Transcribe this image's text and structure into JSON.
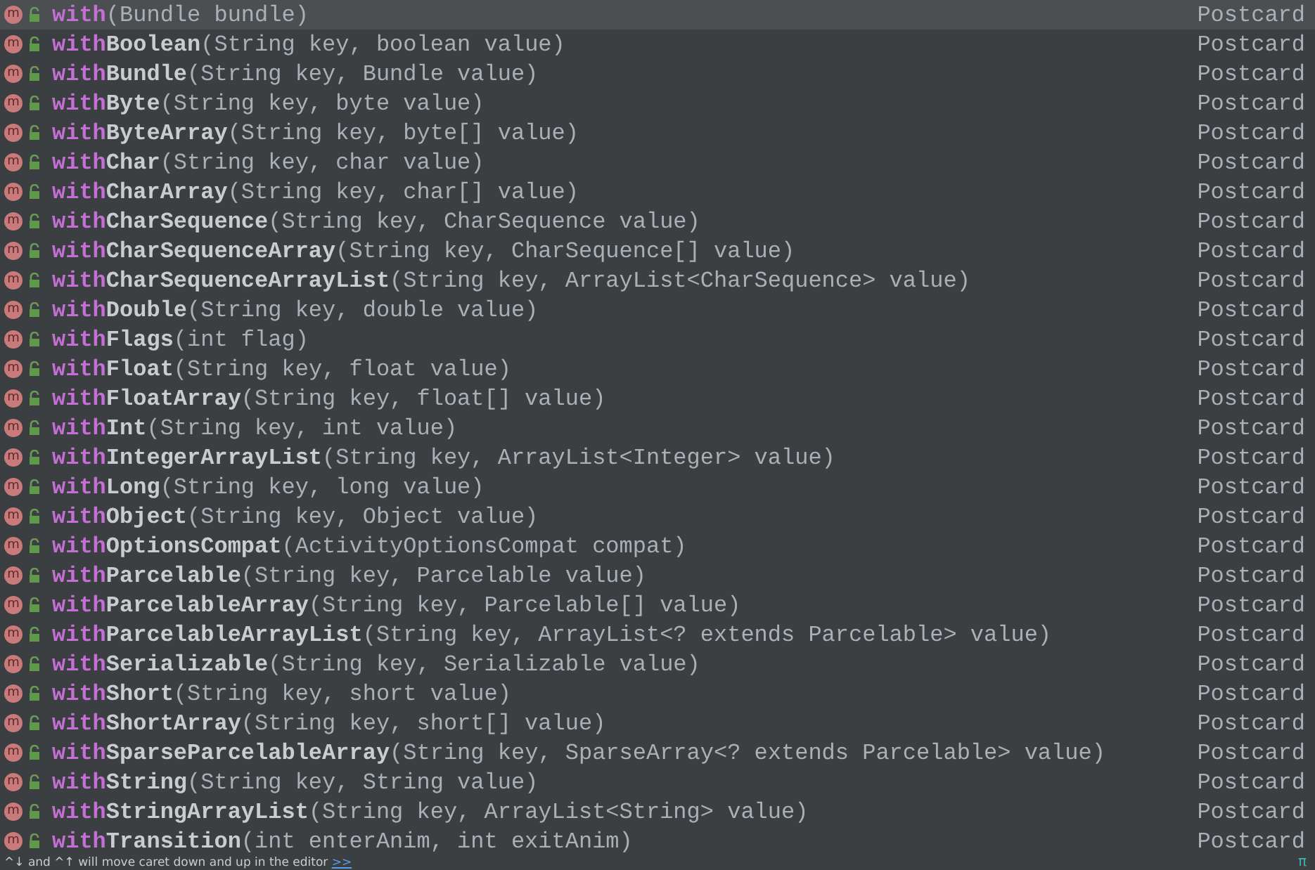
{
  "completion_list": {
    "rows": [
      {
        "badge": "m",
        "match": "with",
        "name": "",
        "params": "(Bundle bundle)",
        "type": "Postcard",
        "selected": true
      },
      {
        "badge": "m",
        "match": "with",
        "name": "Boolean",
        "params": "(String key, boolean value)",
        "type": "Postcard",
        "selected": false
      },
      {
        "badge": "m",
        "match": "with",
        "name": "Bundle",
        "params": "(String key, Bundle value)",
        "type": "Postcard",
        "selected": false
      },
      {
        "badge": "m",
        "match": "with",
        "name": "Byte",
        "params": "(String key, byte value)",
        "type": "Postcard",
        "selected": false
      },
      {
        "badge": "m",
        "match": "with",
        "name": "ByteArray",
        "params": "(String key, byte[] value)",
        "type": "Postcard",
        "selected": false
      },
      {
        "badge": "m",
        "match": "with",
        "name": "Char",
        "params": "(String key, char value)",
        "type": "Postcard",
        "selected": false
      },
      {
        "badge": "m",
        "match": "with",
        "name": "CharArray",
        "params": "(String key, char[] value)",
        "type": "Postcard",
        "selected": false
      },
      {
        "badge": "m",
        "match": "with",
        "name": "CharSequence",
        "params": "(String key, CharSequence value)",
        "type": "Postcard",
        "selected": false
      },
      {
        "badge": "m",
        "match": "with",
        "name": "CharSequenceArray",
        "params": "(String key, CharSequence[] value)",
        "type": "Postcard",
        "selected": false
      },
      {
        "badge": "m",
        "match": "with",
        "name": "CharSequenceArrayList",
        "params": "(String key, ArrayList<CharSequence> value)",
        "type": "Postcard",
        "selected": false
      },
      {
        "badge": "m",
        "match": "with",
        "name": "Double",
        "params": "(String key, double value)",
        "type": "Postcard",
        "selected": false
      },
      {
        "badge": "m",
        "match": "with",
        "name": "Flags",
        "params": "(int flag)",
        "type": "Postcard",
        "selected": false
      },
      {
        "badge": "m",
        "match": "with",
        "name": "Float",
        "params": "(String key, float value)",
        "type": "Postcard",
        "selected": false
      },
      {
        "badge": "m",
        "match": "with",
        "name": "FloatArray",
        "params": "(String key, float[] value)",
        "type": "Postcard",
        "selected": false
      },
      {
        "badge": "m",
        "match": "with",
        "name": "Int",
        "params": "(String key, int value)",
        "type": "Postcard",
        "selected": false
      },
      {
        "badge": "m",
        "match": "with",
        "name": "IntegerArrayList",
        "params": "(String key, ArrayList<Integer> value)",
        "type": "Postcard",
        "selected": false
      },
      {
        "badge": "m",
        "match": "with",
        "name": "Long",
        "params": "(String key, long value)",
        "type": "Postcard",
        "selected": false
      },
      {
        "badge": "m",
        "match": "with",
        "name": "Object",
        "params": "(String key, Object value)",
        "type": "Postcard",
        "selected": false
      },
      {
        "badge": "m",
        "match": "with",
        "name": "OptionsCompat",
        "params": "(ActivityOptionsCompat compat)",
        "type": "Postcard",
        "selected": false
      },
      {
        "badge": "m",
        "match": "with",
        "name": "Parcelable",
        "params": "(String key, Parcelable value)",
        "type": "Postcard",
        "selected": false
      },
      {
        "badge": "m",
        "match": "with",
        "name": "ParcelableArray",
        "params": "(String key, Parcelable[] value)",
        "type": "Postcard",
        "selected": false
      },
      {
        "badge": "m",
        "match": "with",
        "name": "ParcelableArrayList",
        "params": "(String key, ArrayList<? extends Parcelable> value)",
        "type": "Postcard",
        "selected": false
      },
      {
        "badge": "m",
        "match": "with",
        "name": "Serializable",
        "params": "(String key, Serializable value)",
        "type": "Postcard",
        "selected": false
      },
      {
        "badge": "m",
        "match": "with",
        "name": "Short",
        "params": "(String key, short value)",
        "type": "Postcard",
        "selected": false
      },
      {
        "badge": "m",
        "match": "with",
        "name": "ShortArray",
        "params": "(String key, short[] value)",
        "type": "Postcard",
        "selected": false
      },
      {
        "badge": "m",
        "match": "with",
        "name": "SparseParcelableArray",
        "params": "(String key, SparseArray<? extends Parcelable> value)",
        "type": "Postcard",
        "selected": false
      },
      {
        "badge": "m",
        "match": "with",
        "name": "String",
        "params": "(String key, String value)",
        "type": "Postcard",
        "selected": false
      },
      {
        "badge": "m",
        "match": "with",
        "name": "StringArrayList",
        "params": "(String key, ArrayList<String> value)",
        "type": "Postcard",
        "selected": false
      },
      {
        "badge": "m",
        "match": "with",
        "name": "Transition",
        "params": "(int enterAnim, int exitAnim)",
        "type": "Postcard",
        "selected": false
      }
    ]
  },
  "footer": {
    "hint": "^↓ and ^↑ will move caret down and up in the editor",
    "link": ">>",
    "corner": "π"
  }
}
